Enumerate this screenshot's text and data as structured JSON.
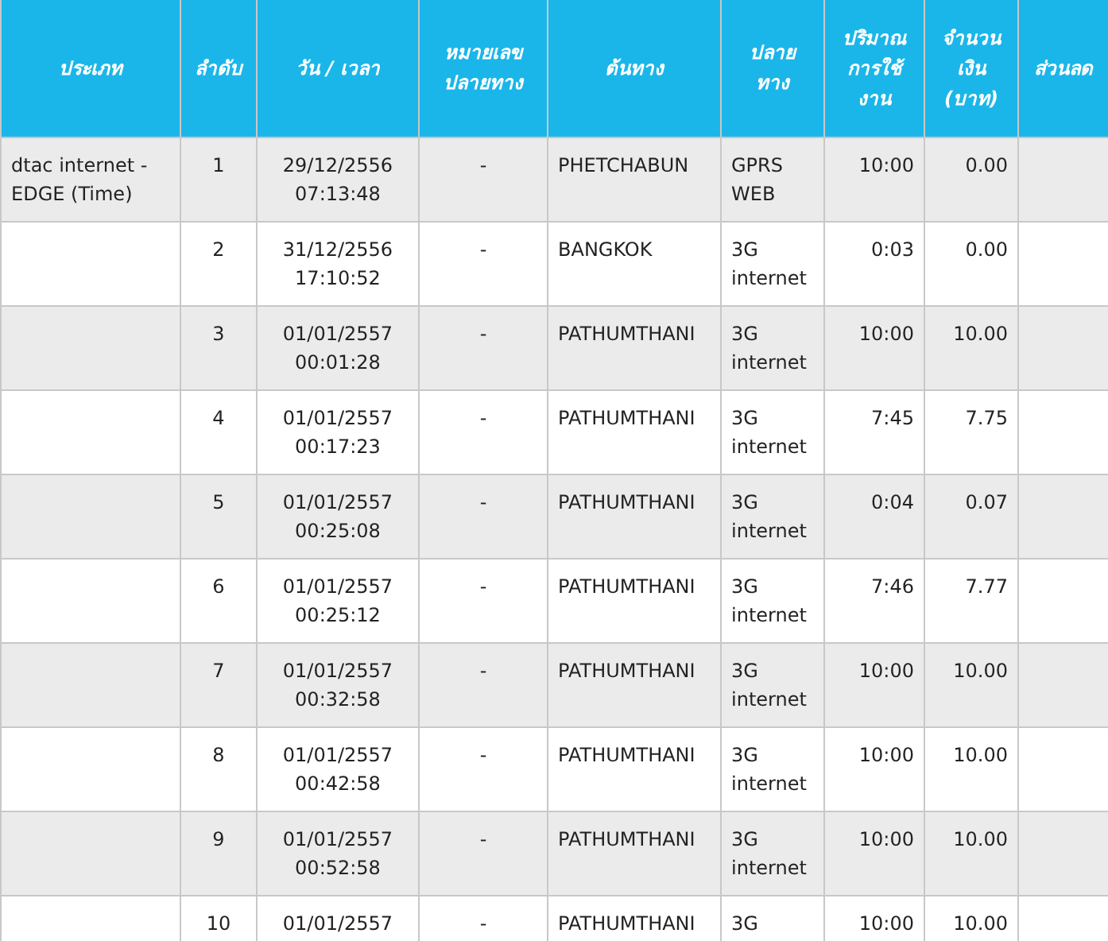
{
  "table": {
    "columns": [
      "ประเภท",
      "ลำดับ",
      "วัน / เวลา",
      "หมายเลข ปลายทาง",
      "ต้นทาง",
      "ปลาย ทาง",
      "ปริมาณ การใช้ งาน",
      "จำนวน เงิน (บาท)",
      "ส่วนลด"
    ],
    "rows": [
      {
        "type": "dtac internet - EDGE (Time)",
        "seq": "1",
        "date": "29/12/2556",
        "time": "07:13:48",
        "number": "-",
        "origin": "PHETCHABUN",
        "destination": "GPRS WEB",
        "usage": "10:00",
        "amount": "0.00"
      },
      {
        "type": "",
        "seq": "2",
        "date": "31/12/2556",
        "time": "17:10:52",
        "number": "-",
        "origin": "BANGKOK",
        "destination": "3G internet",
        "usage": "0:03",
        "amount": "0.00"
      },
      {
        "seq": "3",
        "date": "01/01/2557",
        "time": "00:01:28",
        "number": "-",
        "origin": "PATHUMTHANI",
        "destination": "3G internet",
        "usage": "10:00",
        "amount": "10.00"
      },
      {
        "seq": "4",
        "date": "01/01/2557",
        "time": "00:17:23",
        "number": "-",
        "origin": "PATHUMTHANI",
        "destination": "3G internet",
        "usage": "7:45",
        "amount": "7.75"
      },
      {
        "seq": "5",
        "date": "01/01/2557",
        "time": "00:25:08",
        "number": "-",
        "origin": "PATHUMTHANI",
        "destination": "3G internet",
        "usage": "0:04",
        "amount": "0.07"
      },
      {
        "seq": "6",
        "date": "01/01/2557",
        "time": "00:25:12",
        "number": "-",
        "origin": "PATHUMTHANI",
        "destination": "3G internet",
        "usage": "7:46",
        "amount": "7.77"
      },
      {
        "seq": "7",
        "date": "01/01/2557",
        "time": "00:32:58",
        "number": "-",
        "origin": "PATHUMTHANI",
        "destination": "3G internet",
        "usage": "10:00",
        "amount": "10.00"
      },
      {
        "seq": "8",
        "date": "01/01/2557",
        "time": "00:42:58",
        "number": "-",
        "origin": "PATHUMTHANI",
        "destination": "3G internet",
        "usage": "10:00",
        "amount": "10.00"
      },
      {
        "seq": "9",
        "date": "01/01/2557",
        "time": "00:52:58",
        "number": "-",
        "origin": "PATHUMTHANI",
        "destination": "3G internet",
        "usage": "10:00",
        "amount": "10.00"
      },
      {
        "seq": "10",
        "date": "01/01/2557",
        "number": "-",
        "origin": "PATHUMTHANI",
        "destination": "3G",
        "usage": "10:00",
        "amount": "10.00"
      }
    ]
  }
}
